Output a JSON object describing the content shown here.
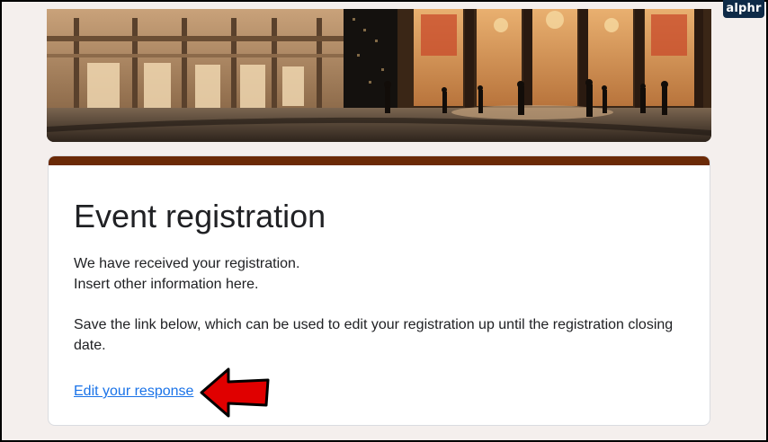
{
  "watermark": {
    "text": "alphr"
  },
  "header": {
    "image": "header-photo"
  },
  "form": {
    "accent_color": "#6b2a07",
    "title": "Event registration",
    "confirmation_line1": "We have received your registration.",
    "confirmation_line2": "Insert other information here.",
    "instructions": "Save the link below, which can be used to edit your registration up until the registration closing date.",
    "edit_link_label": "Edit your response"
  },
  "annotation": {
    "icon": "red-arrow-icon",
    "color": "#e00000"
  }
}
